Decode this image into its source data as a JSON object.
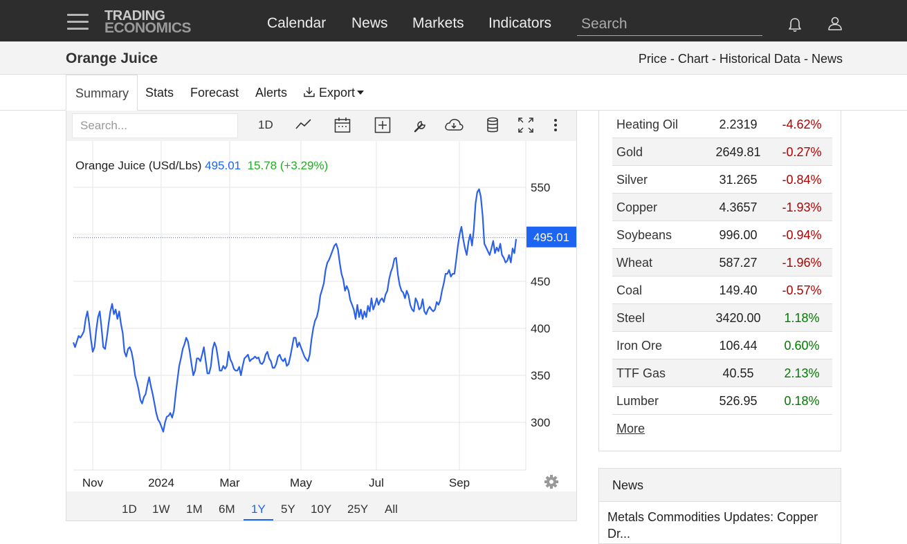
{
  "nav": {
    "logo_line1": "TRADING",
    "logo_line2": "ECONOMICS",
    "links": [
      "Calendar",
      "News",
      "Markets",
      "Indicators"
    ],
    "search_placeholder": "Search"
  },
  "titlebar": {
    "title": "Orange Juice",
    "links": [
      "Price",
      "Chart",
      "Historical Data",
      "News"
    ]
  },
  "tabs": {
    "summary": "Summary",
    "stats": "Stats",
    "forecast": "Forecast",
    "alerts": "Alerts",
    "export": "Export"
  },
  "chart_toolbar": {
    "search_placeholder": "Search...",
    "interval": "1D"
  },
  "chart_legend": {
    "name": "Orange Juice (USd/Lbs)",
    "value": "495.01",
    "change": "15.78 (+3.29%)"
  },
  "chart_data": {
    "type": "line",
    "series": [
      {
        "values": [
          385,
          380,
          386,
          392,
          390,
          393,
          397,
          410,
          418,
          405,
          388,
          375,
          380,
          398,
          412,
          418,
          400,
          380,
          378,
          390,
          405,
          418,
          426,
          415,
          420,
          410,
          418,
          405,
          395,
          375,
          370,
          378,
          380,
          375,
          365,
          350,
          343,
          335,
          324,
          320,
          327,
          330,
          340,
          348,
          338,
          330,
          320,
          310,
          303,
          300,
          295,
          290,
          300,
          306,
          307,
          310,
          305,
          312,
          330,
          345,
          360,
          368,
          378,
          383,
          390,
          386,
          375,
          362,
          350,
          355,
          368,
          368,
          365,
          372,
          380,
          366,
          352,
          352,
          360,
          378,
          385,
          380,
          368,
          355,
          355,
          360,
          357,
          360,
          375,
          367,
          363,
          357,
          355,
          355,
          359,
          350,
          360,
          368,
          370,
          372,
          365,
          367,
          368,
          370,
          368,
          369,
          363,
          362,
          365,
          372,
          375,
          368,
          365,
          358,
          358,
          362,
          370,
          372,
          367,
          365,
          368,
          360,
          362,
          370,
          380,
          390,
          390,
          380,
          385,
          380,
          375,
          370,
          367,
          365,
          372,
          388,
          400,
          408,
          412,
          420,
          435,
          441,
          448,
          462,
          470,
          473,
          478,
          483,
          488,
          490,
          484,
          470,
          458,
          452,
          440,
          445,
          440,
          430,
          425,
          420,
          410,
          425,
          412,
          420,
          410,
          418,
          412,
          424,
          418,
          432,
          420,
          425,
          432,
          425,
          430,
          432,
          428,
          436,
          440,
          452,
          460,
          465,
          474,
          475,
          457,
          446,
          440,
          438,
          432,
          440,
          435,
          425,
          420,
          418,
          432,
          428,
          420,
          422,
          431,
          418,
          415,
          420,
          423,
          420,
          418,
          420,
          428,
          425,
          430,
          440,
          448,
          458,
          458,
          462,
          455,
          458,
          458,
          472,
          488,
          500,
          508,
          495,
          485,
          478,
          492,
          500,
          488,
          505,
          533,
          545,
          548,
          540,
          520,
          490,
          486,
          482,
          478,
          485,
          493,
          480,
          486,
          482,
          490,
          478,
          475,
          470,
          472,
          478,
          470,
          485,
          480,
          495
        ],
        "color": "#2b60e8"
      }
    ],
    "x_tick_labels": [
      "Nov",
      "2024",
      "Mar",
      "May",
      "Jul",
      "Sep"
    ],
    "y_ticks": [
      300,
      350,
      400,
      450,
      500,
      550
    ],
    "ylim": [
      265,
      575
    ],
    "current_value_label": "495.01",
    "grid": true
  },
  "range_buttons": [
    "1D",
    "1W",
    "1M",
    "6M",
    "1Y",
    "5Y",
    "10Y",
    "25Y",
    "All"
  ],
  "commodities": [
    {
      "name": "Heating Oil",
      "price": "2.2319",
      "change": "-4.62%"
    },
    {
      "name": "Gold",
      "price": "2649.81",
      "change": "-0.27%"
    },
    {
      "name": "Silver",
      "price": "31.265",
      "change": "-0.84%"
    },
    {
      "name": "Copper",
      "price": "4.3657",
      "change": "-1.93%"
    },
    {
      "name": "Soybeans",
      "price": "996.00",
      "change": "-0.94%"
    },
    {
      "name": "Wheat",
      "price": "587.27",
      "change": "-1.96%"
    },
    {
      "name": "Coal",
      "price": "149.40",
      "change": "-0.57%"
    },
    {
      "name": "Steel",
      "price": "3420.00",
      "change": "1.18%"
    },
    {
      "name": "Iron Ore",
      "price": "106.44",
      "change": "0.60%"
    },
    {
      "name": "TTF Gas",
      "price": "40.55",
      "change": "2.13%"
    },
    {
      "name": "Lumber",
      "price": "526.95",
      "change": "0.18%"
    }
  ],
  "more_label": "More",
  "news": {
    "header": "News",
    "item": "Metals Commodities Updates: Copper Dr..."
  },
  "colors": {
    "navbar": "#2d2d2d",
    "line": "#2b60e8",
    "positive": "#007a00",
    "negative": "#b30000",
    "accent": "#1c64f2"
  }
}
